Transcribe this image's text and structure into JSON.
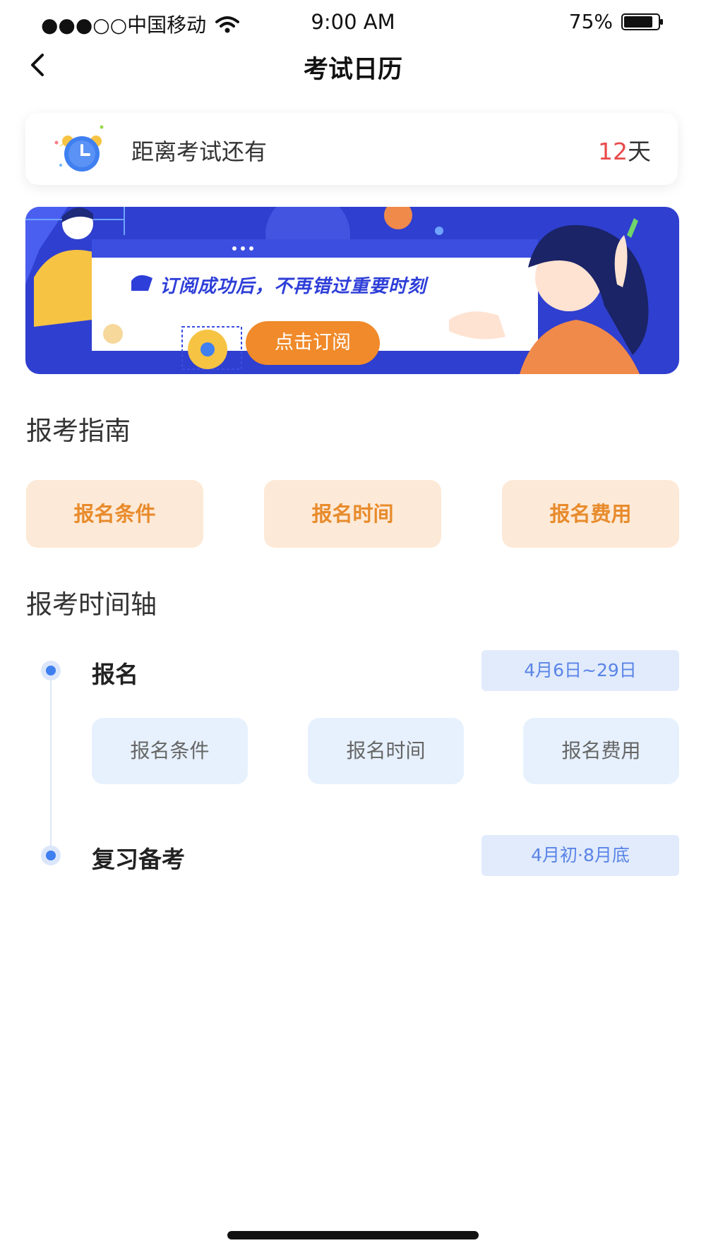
{
  "status_bar": {
    "carrier": "●●●○○中国移动",
    "time": "9:00 AM",
    "battery": "75%"
  },
  "nav": {
    "title": "考试日历"
  },
  "countdown": {
    "label": "距离考试还有",
    "value": "12",
    "unit": "天"
  },
  "banner": {
    "text": "订阅成功后，不再错过重要时刻",
    "button_label": "点击订阅"
  },
  "guide": {
    "title": "报考指南",
    "buttons": [
      "报名条件",
      "报名时间",
      "报名费用"
    ]
  },
  "timeline": {
    "title": "报考时间轴",
    "items": [
      {
        "title": "报名",
        "date": "4月6日~29日",
        "buttons": [
          "报名条件",
          "报名时间",
          "报名费用"
        ]
      },
      {
        "title": "复习备考",
        "date": "4月初·8月底"
      }
    ]
  },
  "colors": {
    "accent_orange": "#f08a2a",
    "guide_bg": "#fde9d7",
    "timeline_blue": "#3f7ff0",
    "countdown_red": "#e84a4a"
  }
}
